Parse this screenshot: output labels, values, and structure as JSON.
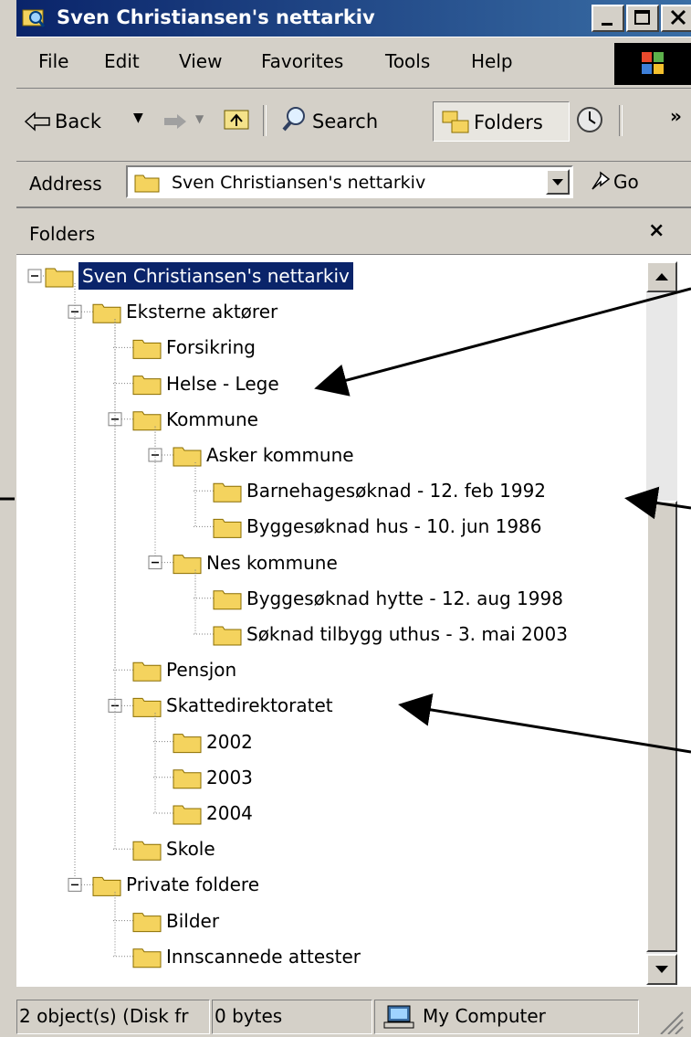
{
  "window": {
    "title": "Sven Christiansen's nettarkiv",
    "icon": "folder-search-icon"
  },
  "menu": [
    "File",
    "Edit",
    "View",
    "Favorites",
    "Tools",
    "Help"
  ],
  "toolbar": {
    "back": "Back",
    "search": "Search",
    "folders": "Folders",
    "more": "»"
  },
  "address": {
    "label": "Address",
    "value": "Sven Christiansen's nettarkiv",
    "go": "Go"
  },
  "pane": {
    "title": "Folders",
    "close": "×"
  },
  "tree": [
    {
      "label": "Sven Christiansen's nettarkiv",
      "level": 0,
      "expanded": true,
      "selected": true
    },
    {
      "label": "Eksterne aktører",
      "level": 1,
      "expanded": true
    },
    {
      "label": "Forsikring",
      "level": 2
    },
    {
      "label": "Helse - Lege",
      "level": 2
    },
    {
      "label": "Kommune",
      "level": 2,
      "expanded": true
    },
    {
      "label": "Asker kommune",
      "level": 3,
      "expanded": true
    },
    {
      "label": "Barnehagesøknad - 12. feb 1992",
      "level": 4
    },
    {
      "label": "Byggesøknad hus - 10. jun 1986",
      "level": 4
    },
    {
      "label": "Nes kommune",
      "level": 3,
      "expanded": true
    },
    {
      "label": "Byggesøknad hytte - 12. aug 1998",
      "level": 4
    },
    {
      "label": "Søknad tilbygg uthus - 3. mai 2003",
      "level": 4
    },
    {
      "label": "Pensjon",
      "level": 2
    },
    {
      "label": "Skattedirektoratet",
      "level": 2,
      "expanded": true
    },
    {
      "label": "2002",
      "level": 3
    },
    {
      "label": "2003",
      "level": 3
    },
    {
      "label": "2004",
      "level": 3
    },
    {
      "label": "Skole",
      "level": 2
    },
    {
      "label": "Private foldere",
      "level": 1,
      "expanded": true
    },
    {
      "label": "Bilder",
      "level": 2
    },
    {
      "label": "Innscannede attester",
      "level": 2
    }
  ],
  "status": {
    "objects": "2 object(s) (Disk fr",
    "size": "0 bytes",
    "zone": "My Computer"
  }
}
